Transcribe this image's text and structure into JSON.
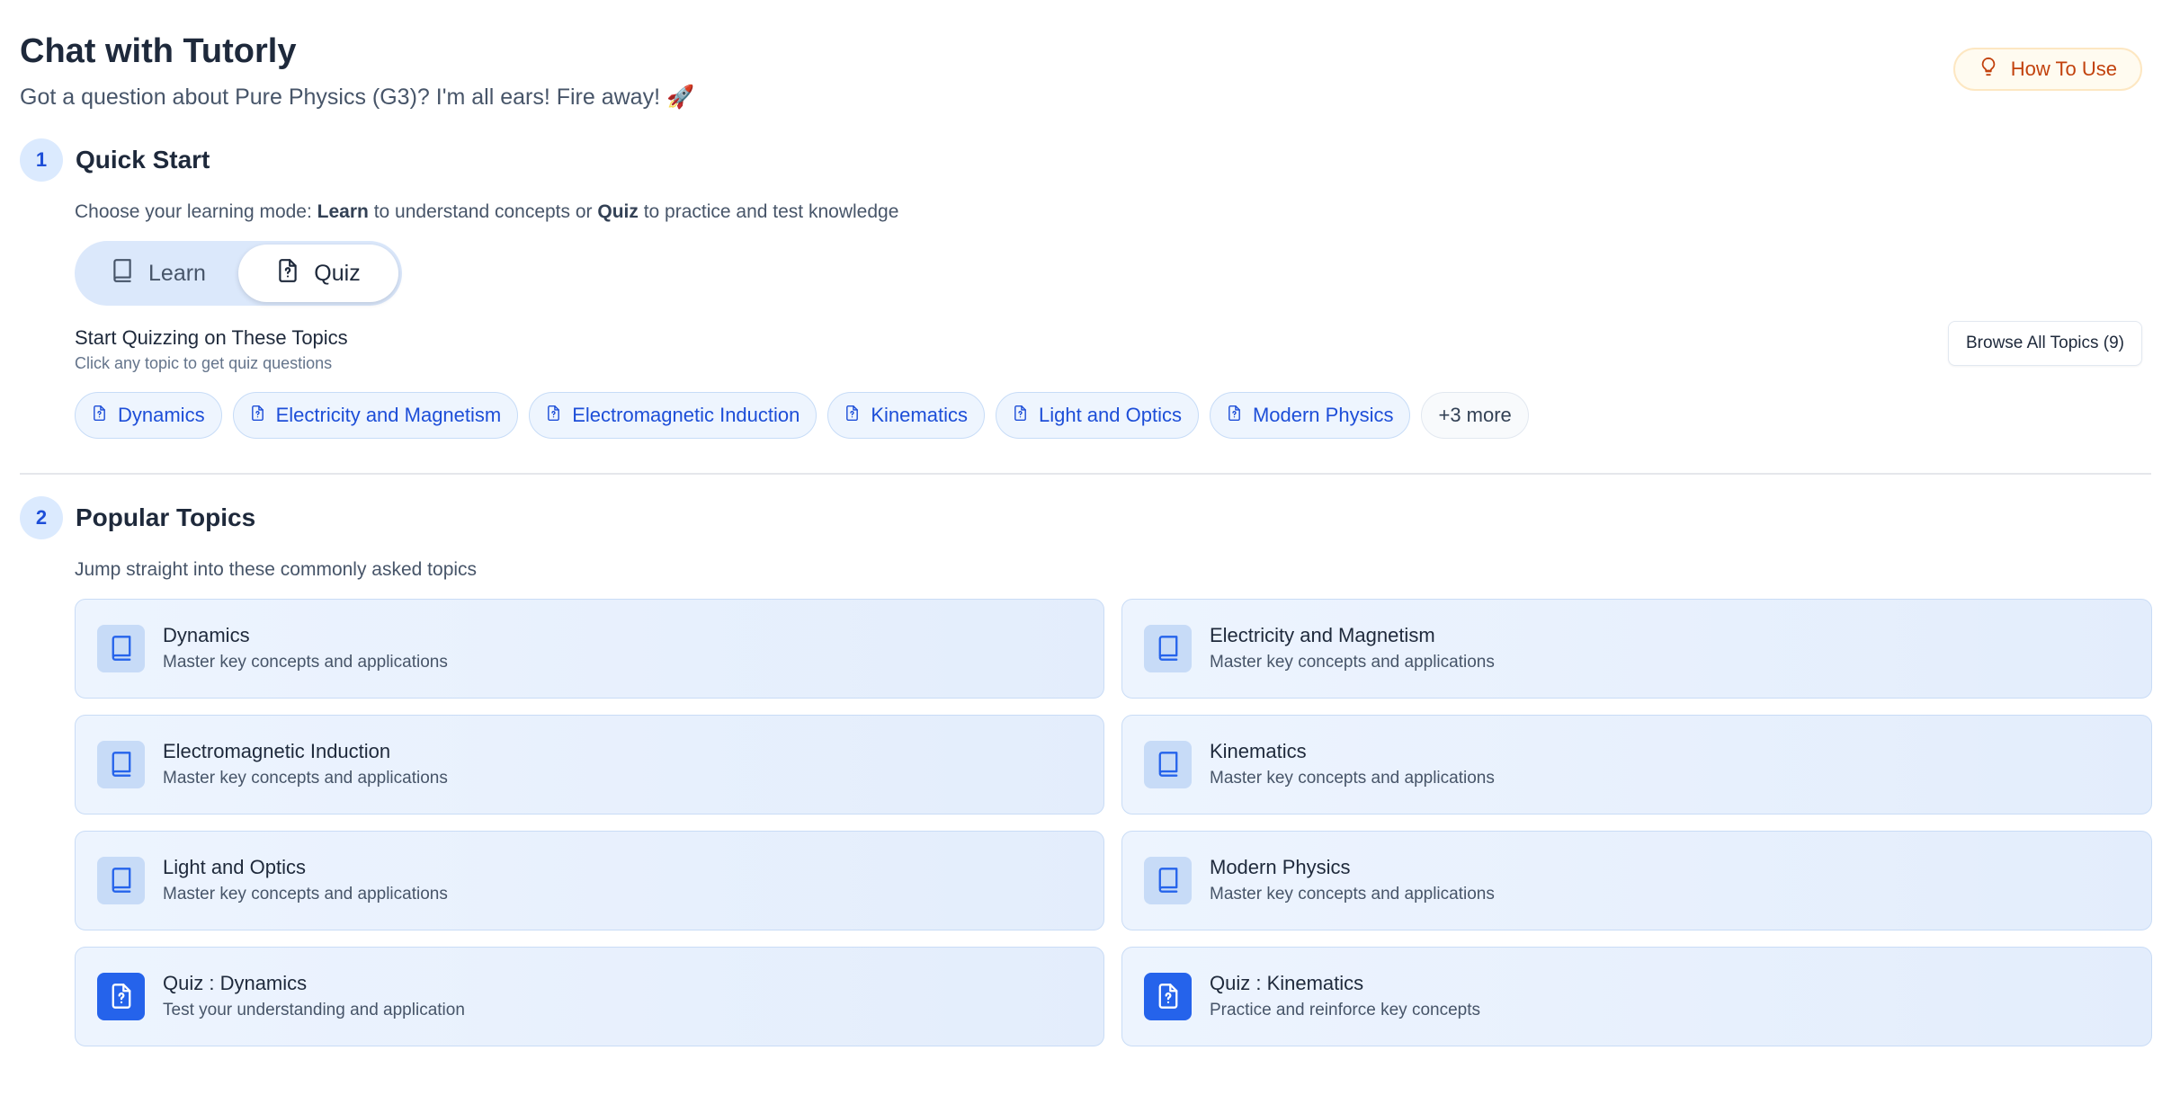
{
  "header": {
    "title": "Chat with Tutorly",
    "subtitle": "Got a question about Pure Physics (G3)? I'm all ears! Fire away! 🚀",
    "how_to_use_label": "How To Use"
  },
  "quick_start": {
    "step": "1",
    "title": "Quick Start",
    "desc_prefix": "Choose your learning mode: ",
    "desc_learn": "Learn",
    "desc_mid": " to understand concepts or ",
    "desc_quiz": "Quiz",
    "desc_suffix": " to practice and test knowledge",
    "modes": {
      "learn_label": "Learn",
      "quiz_label": "Quiz",
      "selected": "Quiz"
    },
    "quiz_topics_title": "Start Quizzing on These Topics",
    "quiz_topics_hint": "Click any topic to get quiz questions",
    "browse_label": "Browse All Topics (9)",
    "chips": [
      "Dynamics",
      "Electricity and Magnetism",
      "Electromagnetic Induction",
      "Kinematics",
      "Light and Optics",
      "Modern Physics"
    ],
    "more_label": "+3 more"
  },
  "popular_topics": {
    "step": "2",
    "title": "Popular Topics",
    "desc": "Jump straight into these commonly asked topics",
    "cards": [
      {
        "title": "Dynamics",
        "subtitle": "Master key concepts and applications",
        "icon": "book-icon"
      },
      {
        "title": "Electricity and Magnetism",
        "subtitle": "Master key concepts and applications",
        "icon": "book-icon"
      },
      {
        "title": "Electromagnetic Induction",
        "subtitle": "Master key concepts and applications",
        "icon": "book-icon"
      },
      {
        "title": "Kinematics",
        "subtitle": "Master key concepts and applications",
        "icon": "book-icon"
      },
      {
        "title": "Light and Optics",
        "subtitle": "Master key concepts and applications",
        "icon": "book-icon"
      },
      {
        "title": "Modern Physics",
        "subtitle": "Master key concepts and applications",
        "icon": "book-icon"
      },
      {
        "title": "Quiz : Dynamics",
        "subtitle": "Test your understanding and application",
        "icon": "quiz-file-icon"
      },
      {
        "title": "Quiz : Kinematics",
        "subtitle": "Practice and reinforce key concepts",
        "icon": "quiz-file-icon"
      }
    ]
  },
  "colors": {
    "accent": "#2563eb",
    "howto_text": "#c2410c",
    "card_border": "#c9dcf6"
  }
}
